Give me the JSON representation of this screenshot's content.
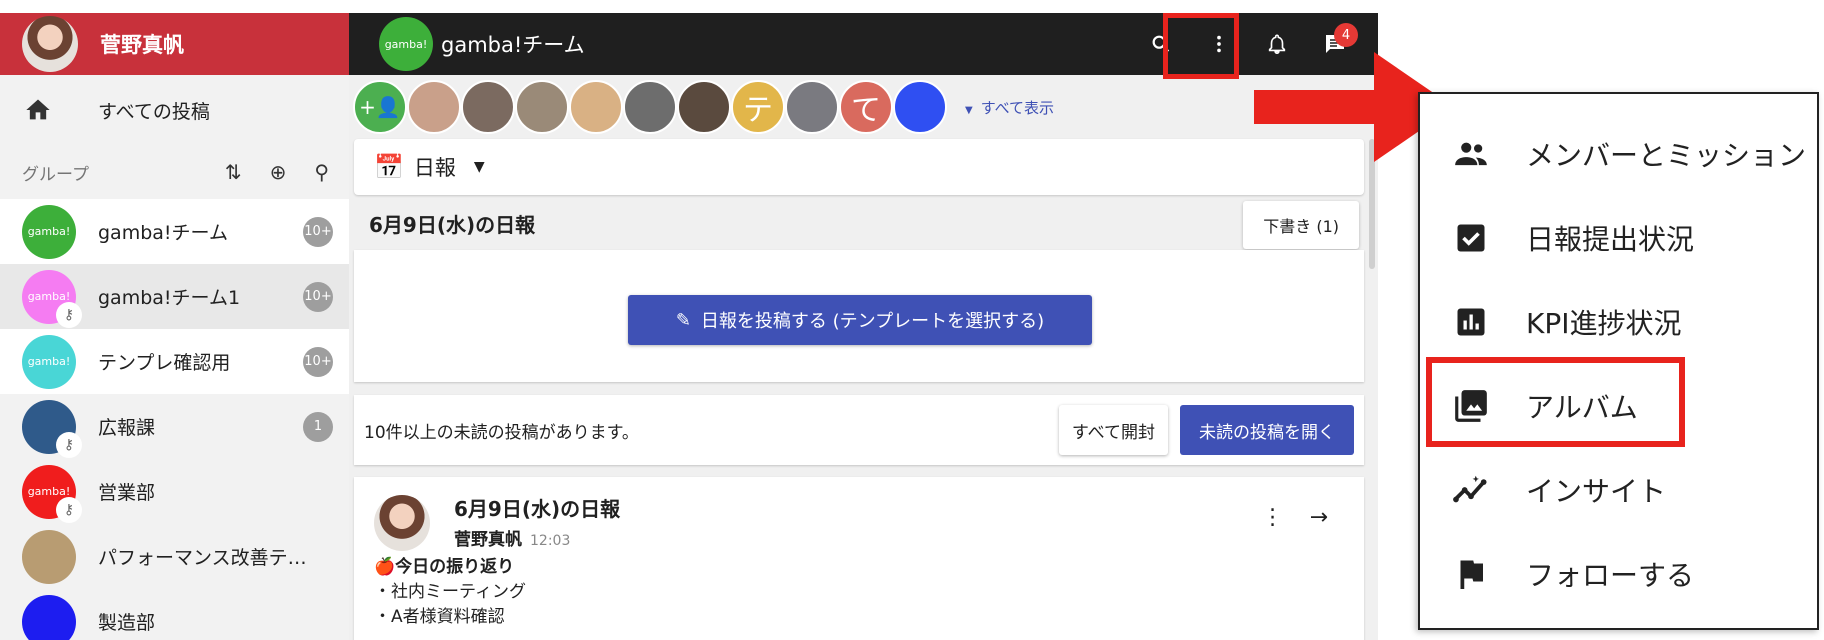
{
  "user": {
    "name": "菅野真帆"
  },
  "sidebar": {
    "all_posts": "すべての投稿",
    "group_header": "グループ",
    "groups": [
      {
        "name": "gamba!チーム",
        "logo": "gamba!",
        "color": "#3daf3a",
        "count": "10+",
        "locked": false
      },
      {
        "name": "gamba!チーム1",
        "logo": "gamba!",
        "color": "#f57cf2",
        "count": "10+",
        "locked": true
      },
      {
        "name": "テンプレ確認用",
        "logo": "gamba!",
        "color": "#49d6d6",
        "count": "10+",
        "locked": false
      },
      {
        "name": "広報課",
        "logo": "",
        "color": "#2f5a8a",
        "count": "1",
        "locked": true
      },
      {
        "name": "営業部",
        "logo": "gamba!",
        "color": "#f01d1d",
        "count": "",
        "locked": true
      },
      {
        "name": "パフォーマンス改善テス...",
        "logo": "",
        "color": "#b89c72",
        "count": "",
        "locked": false
      },
      {
        "name": "製造部",
        "logo": "",
        "color": "#1d1df0",
        "count": "",
        "locked": false
      }
    ]
  },
  "topbar": {
    "team_name": "gamba!チーム",
    "team_logo": "gamba!",
    "message_badge": "4"
  },
  "members": {
    "items": [
      {
        "label": "",
        "color": "#4caf50"
      },
      {
        "label": "",
        "color": "#c9a08a"
      },
      {
        "label": "",
        "color": "#7b6a60"
      },
      {
        "label": "",
        "color": "#9a8a78"
      },
      {
        "label": "",
        "color": "#d9b184"
      },
      {
        "label": "",
        "color": "#6d6d6d"
      },
      {
        "label": "",
        "color": "#5a4a3e"
      },
      {
        "label": "テ",
        "color": "#e2b64a"
      },
      {
        "label": "",
        "color": "#7a7a80"
      },
      {
        "label": "て",
        "color": "#d96a5e"
      },
      {
        "label": "",
        "color": "#2f4ff2"
      }
    ],
    "show_all": "すべて表示"
  },
  "main": {
    "post_type": "日報",
    "date_title": "6月9日(水)の日報",
    "draft_button": "下書き (1)",
    "post_button": "日報を投稿する (テンプレートを選択する)",
    "unread_text": "10件以上の未読の投稿があります。",
    "open_all": "すべて開封",
    "open_unread": "未読の投稿を開く",
    "entry": {
      "title": "6月9日(水)の日報",
      "author": "菅野真帆",
      "time": "12:03",
      "heading": "🍎今日の振り返り",
      "lines": [
        "・社内ミーティング",
        "・A者様資料確認"
      ]
    }
  },
  "menu": {
    "items": [
      {
        "label": "メンバーとミッション",
        "icon": "people-icon"
      },
      {
        "label": "日報提出状況",
        "icon": "checkbox-icon"
      },
      {
        "label": "KPI進捗状況",
        "icon": "bar-chart-icon"
      },
      {
        "label": "アルバム",
        "icon": "photo-library-icon"
      },
      {
        "label": "インサイト",
        "icon": "insights-icon"
      },
      {
        "label": "フォローする",
        "icon": "flag-icon"
      }
    ]
  },
  "colors": {
    "accent": "#3f51b5",
    "header_red": "#c8313b",
    "highlight": "#e8231d",
    "topbar": "#1f1f1f"
  }
}
